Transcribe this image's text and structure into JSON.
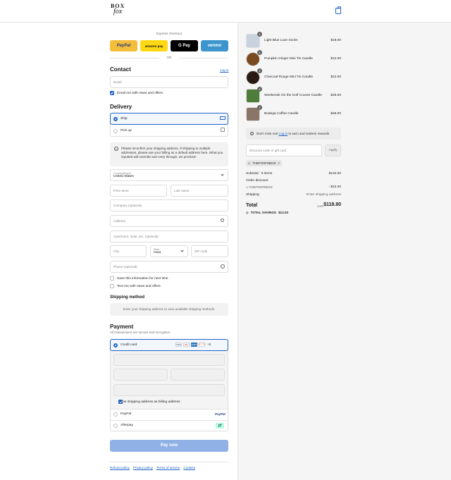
{
  "brand": {
    "line1": "BOX",
    "line2": "fox"
  },
  "express": {
    "title": "Express checkout",
    "or": "OR",
    "paypal": "PayPal",
    "amazon": "amazon pay",
    "gpay": "G Pay",
    "venmo": "venmo"
  },
  "contact": {
    "title": "Contact",
    "login": "Log in",
    "email_placeholder": "Email",
    "news_label": "Email me with news and offers"
  },
  "delivery": {
    "title": "Delivery",
    "ship": "Ship",
    "pickup": "Pick up",
    "notice": "Please reconfirm your shipping address. If shipping to multiple addresses, please use your billing as a default address here. What you inputted will override and carry through, we promise!",
    "country_label": "Country/Region",
    "country_value": "United States",
    "first_name": "First name",
    "last_name": "Last name",
    "company": "Company (optional)",
    "address": "Address",
    "apartment": "Apartment, suite, etc. (optional)",
    "city": "City",
    "state_label": "State",
    "state_value": "Iowa",
    "zip": "ZIP code",
    "phone": "Phone (optional)",
    "save_info": "Save this information for next time",
    "text_me": "Text me with news and offers"
  },
  "shipping_method": {
    "title": "Shipping method",
    "message": "Enter your shipping address to view available shipping methods."
  },
  "payment": {
    "title": "Payment",
    "subtitle": "All transactions are secure and encrypted.",
    "credit_card": "Credit card",
    "more_cards": "+5",
    "billing_same": "Use shipping address as billing address",
    "paypal": "PayPal",
    "paypal_logo": "PayPal",
    "afterpay": "Afterpay",
    "card_logos": [
      "VISA",
      "MC",
      "AMEX",
      "DISCOVER"
    ]
  },
  "pay_now": "Pay now",
  "footer": {
    "links": [
      "Refund policy",
      "Privacy policy",
      "Terms of service",
      "Cookies"
    ]
  },
  "cart": {
    "items": [
      {
        "name": "Light Blue Luxe Socks",
        "qty": "1",
        "price": "$18.00",
        "color": "#c9d3df"
      },
      {
        "name": "Pumpkin Ginger Mini Tin Candle",
        "qty": "1",
        "price": "$12.00",
        "color": "#7a4a22"
      },
      {
        "name": "Charcoal Rouge Mini Tin Candle",
        "qty": "1",
        "price": "$12.00",
        "color": "#2a1a14"
      },
      {
        "name": "Weekends On the Golf Course Candle",
        "qty": "1",
        "price": "$45.00",
        "color": "#4e7d3a"
      },
      {
        "name": "Bodega Coffee Candle",
        "qty": "1",
        "price": "$45.00",
        "color": "#8a7666"
      }
    ],
    "rewards_pre": "Don't miss out!",
    "rewards_link": "Log in",
    "rewards_post": "to earn and redeem rewards",
    "discount_placeholder": "Discount code or gift card",
    "apply": "Apply",
    "code": "THEFOXFIND10",
    "subtotal_label": "Subtotal · 5 items",
    "subtotal": "$132.00",
    "order_discount_label": "Order discount",
    "order_discount_code": "THEFOXFIND10",
    "order_discount": "- $13.20",
    "shipping_label": "Shipping",
    "shipping_value": "Enter shipping address",
    "total_label": "Total",
    "currency": "USD",
    "total": "$118.80",
    "savings_label": "TOTAL SAVINGS",
    "savings": "$13.20"
  },
  "colors": {
    "accent": "#1f63c6",
    "pay_now": "#8fb1e6",
    "paypal": "#f5be3a",
    "amazon": "#ffd814",
    "venmo": "#3d95ce"
  }
}
